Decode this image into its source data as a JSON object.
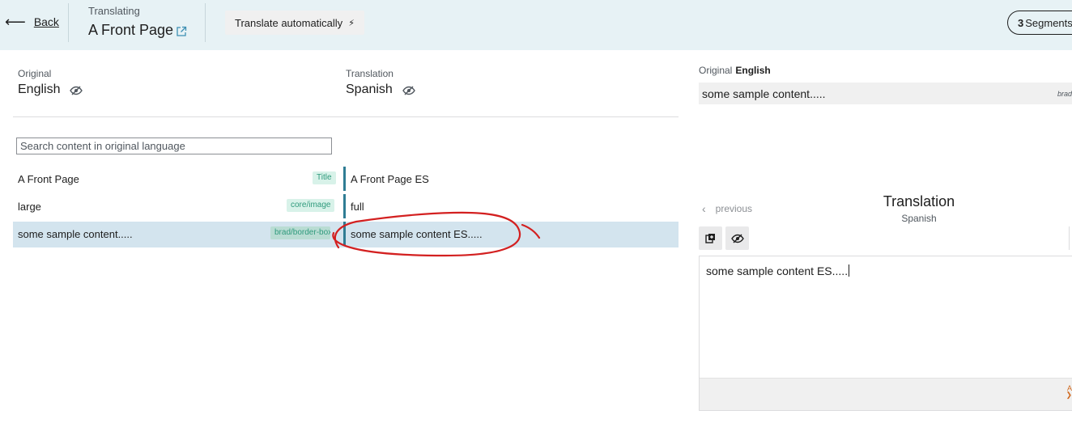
{
  "header": {
    "back_label": "Back",
    "translating_label": "Translating",
    "page_title": "A Front Page",
    "auto_translate_label": "Translate automatically",
    "segments_count": "3",
    "segments_label": "Segments"
  },
  "languages": {
    "original_caption": "Original",
    "original_name": "English",
    "translation_caption": "Translation",
    "translation_name": "Spanish"
  },
  "search": {
    "placeholder": "Search content in original language"
  },
  "rows": [
    {
      "original": "A Front Page",
      "tag": "Title",
      "translation": "A Front Page ES"
    },
    {
      "original": "large",
      "tag": "core/image",
      "translation": "full"
    },
    {
      "original": "some sample content.....",
      "tag": "brad/border-box",
      "translation": "some sample content ES.....",
      "active": true
    }
  ],
  "right_panel": {
    "original_caption": "Original",
    "original_language": "English",
    "original_text": "some sample content.....",
    "original_tag": "brad",
    "previous_label": "previous",
    "translation_title": "Translation",
    "translation_language": "Spanish",
    "editor_text": "some sample content ES.....",
    "footer_mark": "A"
  },
  "colors": {
    "header_bg": "#e7f2f5",
    "active_row_bg": "#d3e4ee",
    "segment_bar": "#2f7d94",
    "tag_bg": "#d8f2e9",
    "tag_text": "#2f9a7c",
    "annotation": "#d32020"
  },
  "icons": {
    "back": "arrow-left-icon",
    "external": "external-link-icon",
    "auto": "bolt-icon",
    "visibility": "eye-slash-icon",
    "previous": "chevron-left-icon",
    "copy": "copy-icon"
  }
}
